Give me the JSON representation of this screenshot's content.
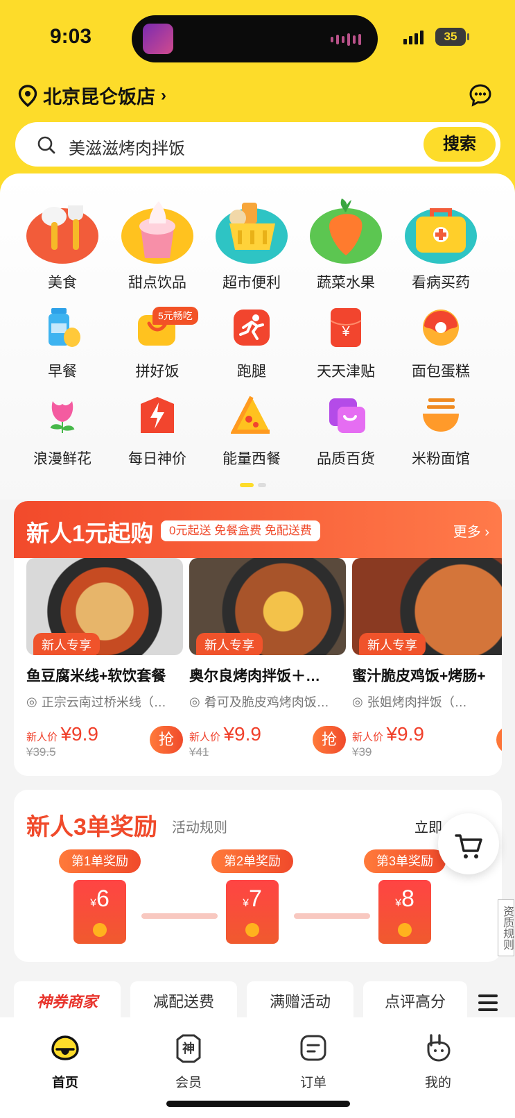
{
  "status_bar": {
    "time": "9:03",
    "battery": "35"
  },
  "header": {
    "location": "北京昆仑饭店",
    "location_chevron": "›"
  },
  "search": {
    "query": "美滋滋烤肉拌饭",
    "button": "搜索"
  },
  "categories": {
    "big": [
      {
        "label": "美食",
        "icon": "tableware-icon"
      },
      {
        "label": "甜点饮品",
        "icon": "ice-cream-icon"
      },
      {
        "label": "超市便利",
        "icon": "shopping-basket-icon"
      },
      {
        "label": "蔬菜水果",
        "icon": "carrot-icon"
      },
      {
        "label": "看病买药",
        "icon": "medicine-box-icon"
      }
    ],
    "small": [
      {
        "label": "早餐",
        "icon": "milk-egg-icon"
      },
      {
        "label": "拼好饭",
        "icon": "group-meal-icon",
        "badge": "5元畅吃"
      },
      {
        "label": "跑腿",
        "icon": "runner-icon"
      },
      {
        "label": "天天津贴",
        "icon": "red-envelope-icon"
      },
      {
        "label": "面包蛋糕",
        "icon": "donut-icon"
      },
      {
        "label": "浪漫鲜花",
        "icon": "rose-icon"
      },
      {
        "label": "每日神价",
        "icon": "lightning-icon"
      },
      {
        "label": "能量西餐",
        "icon": "pizza-icon"
      },
      {
        "label": "品质百货",
        "icon": "handbag-icon"
      },
      {
        "label": "米粉面馆",
        "icon": "noodle-bowl-icon"
      }
    ]
  },
  "new_user": {
    "title": "新人1元起购",
    "tag": "0元起送 免餐盒费 免配送费",
    "more": "更多",
    "deals": [
      {
        "tag": "新人专享",
        "name": "鱼豆腐米线+软饮套餐",
        "shop": "正宗云南过桥米线（…",
        "price_label": "新人价",
        "price": "¥9.9",
        "original": "¥39.5",
        "grab": "抢"
      },
      {
        "tag": "新人专享",
        "name": "奥尔良烤肉拌饭＋…",
        "shop": "肴可及脆皮鸡烤肉饭…",
        "price_label": "新人价",
        "price": "¥9.9",
        "original": "¥41",
        "grab": "抢"
      },
      {
        "tag": "新人专享",
        "name": "蜜汁脆皮鸡饭+烤肠+",
        "shop": "张姐烤肉拌饭（…",
        "price_label": "新人价",
        "price": "¥9.9",
        "original": "¥39",
        "grab": "抢"
      }
    ]
  },
  "reward": {
    "title": "新人3单奖励",
    "rule": "活动规则",
    "go": "立即",
    "steps": [
      {
        "label": "第1单奖励",
        "currency": "¥",
        "amount": "6"
      },
      {
        "label": "第2单奖励",
        "currency": "¥",
        "amount": "7"
      },
      {
        "label": "第3单奖励",
        "currency": "¥",
        "amount": "8"
      }
    ]
  },
  "side": {
    "qualification": "资质规则"
  },
  "filters": [
    "神券商家",
    "减配送费",
    "满赠活动",
    "点评高分"
  ],
  "tabbar": [
    {
      "label": "首页",
      "icon": "home-duck-icon",
      "active": true
    },
    {
      "label": "会员",
      "icon": "member-icon",
      "active": false
    },
    {
      "label": "订单",
      "icon": "order-icon",
      "active": false
    },
    {
      "label": "我的",
      "icon": "profile-icon",
      "active": false
    }
  ],
  "colors": {
    "brand_yellow": "#fddc2a",
    "accent_red": "#f04a2b"
  }
}
